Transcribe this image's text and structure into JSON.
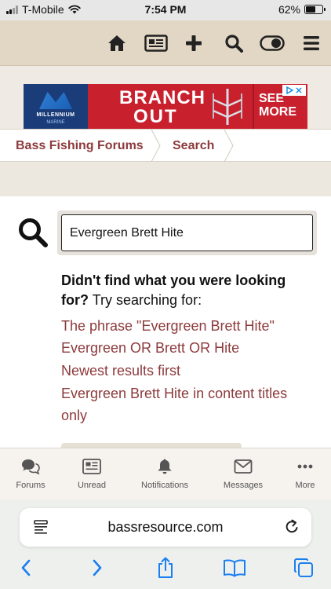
{
  "status_bar": {
    "carrier": "T-Mobile",
    "time": "7:54 PM",
    "battery": "62%",
    "battery_level": 0.62,
    "signal_bars": 2
  },
  "header": {
    "icons": [
      "home-icon",
      "newspaper-icon",
      "plus-icon",
      "search-icon",
      "toggle-icon",
      "menu-icon"
    ]
  },
  "ad": {
    "brand": "MILLENNIUM",
    "brand_sub": "MARINE",
    "line1": "BRANCH",
    "line2": "OUT",
    "cta": "SEE MORE"
  },
  "breadcrumb": {
    "items": [
      "Bass Fishing Forums",
      "Search"
    ]
  },
  "search": {
    "query": "Evergreen Brett Hite",
    "no_results_bold": "Didn't find what you were looking for?",
    "no_results_rest": "Try searching for:",
    "suggestions": [
      "The phrase \"Evergreen Brett Hite\"",
      "Evergreen OR Brett OR Hite",
      "Newest results first",
      "Evergreen Brett Hite in content titles only"
    ]
  },
  "tabbar": {
    "items": [
      {
        "label": "Forums",
        "icon": "chat-bubbles-icon"
      },
      {
        "label": "Unread",
        "icon": "newspaper-icon"
      },
      {
        "label": "Notifications",
        "icon": "bell-icon"
      },
      {
        "label": "Messages",
        "icon": "envelope-icon"
      },
      {
        "label": "More",
        "icon": "ellipsis-icon"
      }
    ]
  },
  "browser": {
    "url": "bassresource.com"
  },
  "colors": {
    "accent": "#8d3a3c",
    "header_bg": "#e2d6c4",
    "ad_red": "#c9202e"
  }
}
